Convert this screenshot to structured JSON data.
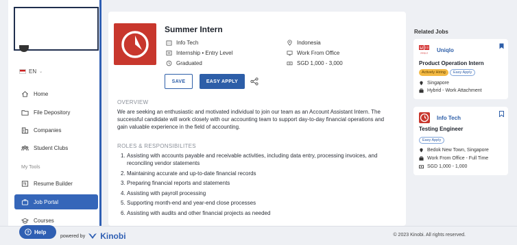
{
  "sidebar": {
    "language": "EN",
    "nav": [
      {
        "label": "Home",
        "icon": "home-icon"
      },
      {
        "label": "File Depository",
        "icon": "folder-icon"
      },
      {
        "label": "Companies",
        "icon": "building-icon"
      },
      {
        "label": "Student Clubs",
        "icon": "users-icon"
      },
      {
        "label": "Resume Builder",
        "icon": "resume-icon"
      },
      {
        "label": "Job Portal",
        "icon": "briefcase-icon"
      },
      {
        "label": "Courses",
        "icon": "graduation-cap-icon"
      }
    ],
    "section_label": "My Tools",
    "active_item": "Job Portal"
  },
  "job": {
    "title": "Summer Intern",
    "company": "Info Tech",
    "type": "Internship • Entry Level",
    "education": "Graduated",
    "location": "Indonesia",
    "work_mode": "Work From Office",
    "salary": "SGD 1,000 - 3,000",
    "save_label": "SAVE",
    "apply_label": "EASY APPLY",
    "overview_heading": "OVERVIEW",
    "overview": "We are seeking an enthusiastic and motivated individual to join our team as an Account Assistant Intern. The successful candidate will work closely with our accounting team to support day-to-day financial operations and gain valuable experience in the field of accounting.",
    "roles_heading": "ROLES & RESPONSIBILITES",
    "roles": [
      "Assisting with accounts payable and receivable activities, including data entry, processing invoices, and reconciling vendor statements",
      "Maintaining accurate and up-to-date financial records",
      "Preparing financial reports and statements",
      "Assisting with payroll processing",
      "Supporting month-end and year-end close processes",
      "Assisting with audits and other financial projects as needed"
    ]
  },
  "related": {
    "title": "Related Jobs",
    "jobs": [
      {
        "company": "Uniqlo",
        "logo_text": "UNIQLO",
        "title": "Product Operation Intern",
        "badges": [
          "Actively Hiring",
          "Easy Apply"
        ],
        "location": "Singapore",
        "work": "Hybrid - Work Attachment"
      },
      {
        "company": "Info Tech",
        "title": "Testing Engineer",
        "badges": [
          "Easy Apply"
        ],
        "location": "Bedok New Town, Singapore",
        "work": "Work From Office - Full Time",
        "salary": "SGD 1,000 - 1,000"
      }
    ]
  },
  "footer": {
    "help": "Help",
    "powered_by": "powered by",
    "brand": "Kinobi",
    "copyright": "© 2023 Kinobi. All rights reserved."
  },
  "colors": {
    "primary": "#2f5fb3",
    "logo_red": "#c8372d",
    "hiring_badge": "#f3b943"
  }
}
